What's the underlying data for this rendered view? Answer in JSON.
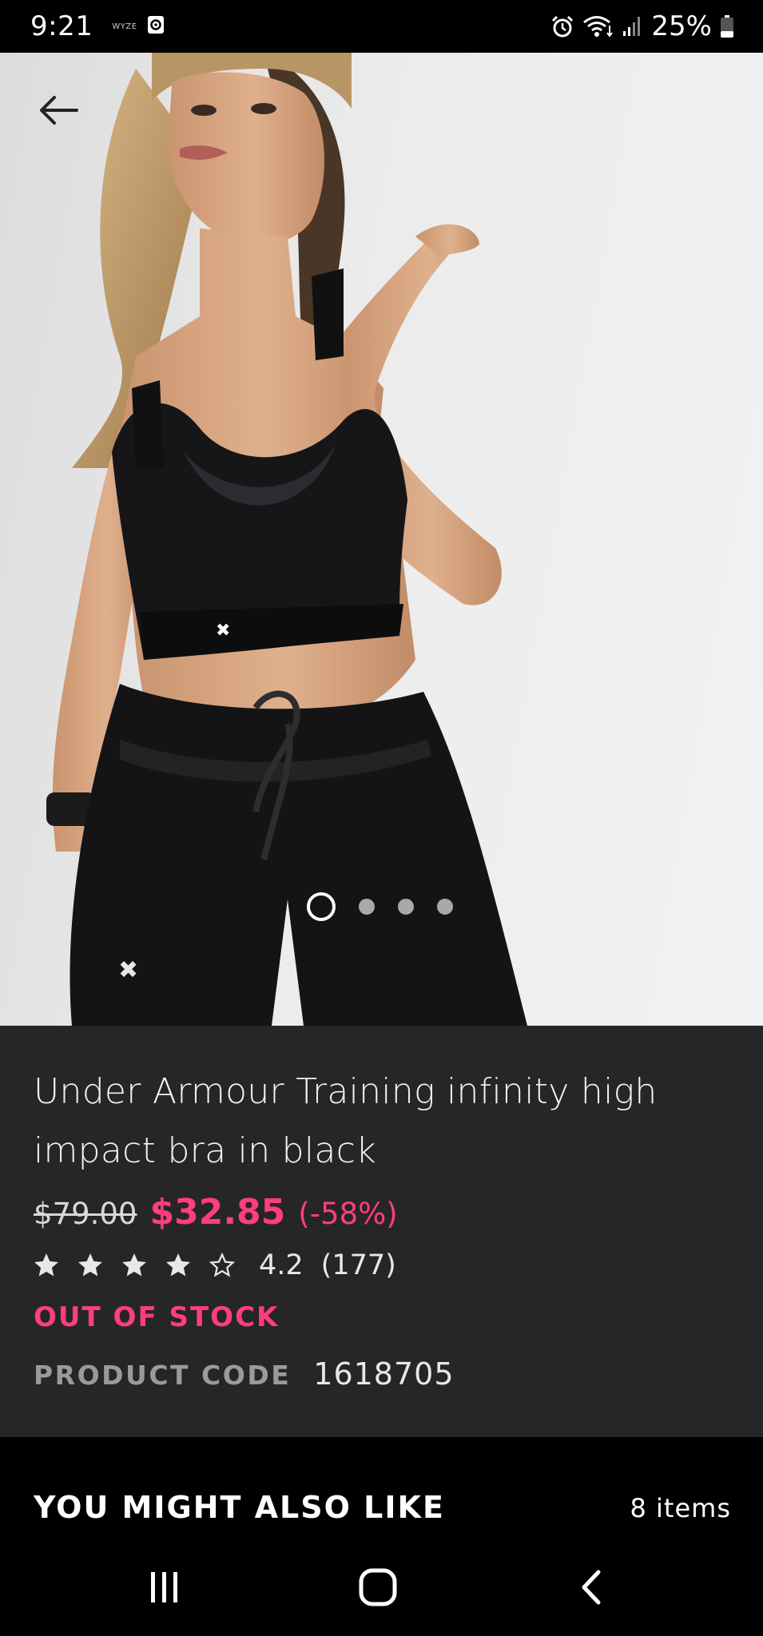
{
  "status_bar": {
    "time": "9:21",
    "wyze_label": "WYZE",
    "battery": "25%"
  },
  "product": {
    "title": "Under Armour Training infinity high impact bra in black",
    "original_price": "$79.00",
    "sale_price": "$32.85",
    "discount": "(-58%)",
    "rating": {
      "value": "4.2",
      "count": "(177)",
      "stars_out_of_5": 4.2
    },
    "stock_status": "OUT OF STOCK",
    "code_label": "PRODUCT CODE",
    "code_value": "1618705"
  },
  "carousel": {
    "total": 4,
    "active_index": 0
  },
  "recommendations": {
    "title": "YOU MIGHT ALSO LIKE",
    "count": "8 items"
  },
  "colors": {
    "accent": "#ff3d7f",
    "panel": "#262626",
    "background": "#000000"
  }
}
